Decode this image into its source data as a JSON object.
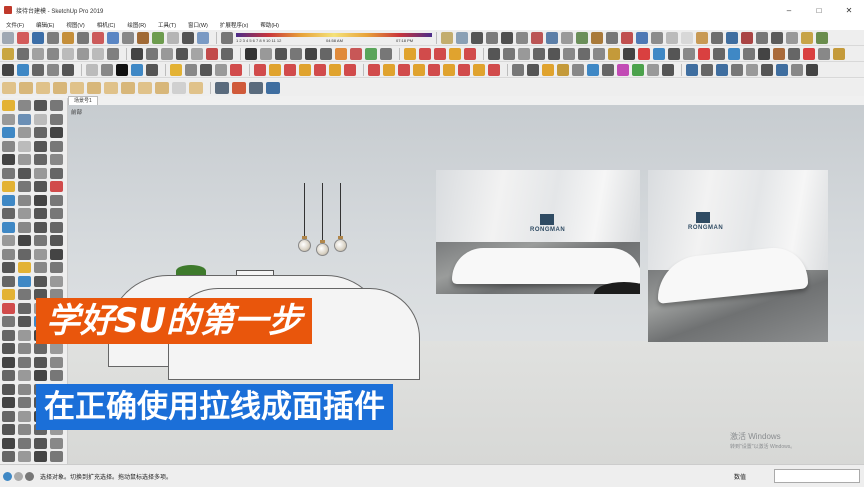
{
  "window": {
    "title": "接待台建模 - SketchUp Pro 2019",
    "controls": {
      "minimize": "–",
      "maximize": "□",
      "close": "✕"
    }
  },
  "menu": [
    "文件(F)",
    "编辑(E)",
    "视图(V)",
    "相机(C)",
    "绘图(R)",
    "工具(T)",
    "窗口(W)",
    "扩展程序(x)",
    "帮助(H)"
  ],
  "shadow_bar": {
    "times": [
      "04:58 AM",
      "07:18 PM"
    ],
    "months": "1 2 3 4 5 6 7 8 9 10 11 12"
  },
  "scene": {
    "tab_label": "场景号1",
    "view_label": "前部"
  },
  "overlay": {
    "line1": "学好SU的第一步",
    "line2": "在正确使用拉线成面插件"
  },
  "photos": {
    "logo_text": "RONGMAN"
  },
  "watermark": {
    "line1": "激活 Windows",
    "line2": "转到\"设置\"以激活 Windows。"
  },
  "status": {
    "hint": "选择对象。切换到扩充选择。拖动鼠标选择多项。",
    "measure_label": "数值"
  },
  "colors": {
    "overlay_orange": "#e9560c",
    "overlay_blue": "#1b6fd8",
    "titlebar_bg": "#ffffff",
    "toolbar_bg": "#eeeeee"
  }
}
